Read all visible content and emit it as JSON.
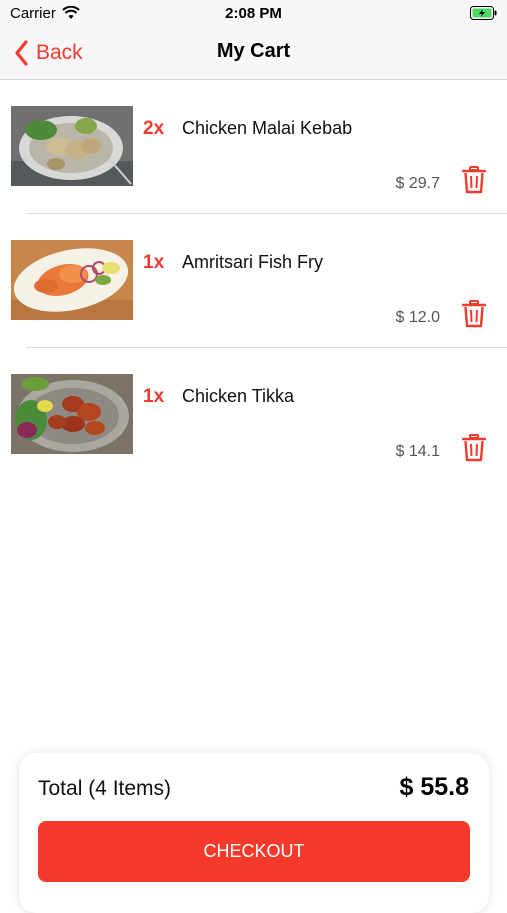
{
  "status_bar": {
    "carrier": "Carrier",
    "time": "2:08 PM"
  },
  "nav": {
    "back_label": "Back",
    "title": "My Cart"
  },
  "cart": {
    "items": [
      {
        "qty": "2x",
        "name": "Chicken Malai Kebab",
        "price": "$ 29.7"
      },
      {
        "qty": "1x",
        "name": "Amritsari Fish Fry",
        "price": "$ 12.0"
      },
      {
        "qty": "1x",
        "name": "Chicken Tikka",
        "price": "$ 14.1"
      }
    ]
  },
  "footer": {
    "total_label": "Total (4 Items)",
    "total_amount": "$ 55.8",
    "checkout_label": "CHECKOUT"
  },
  "colors": {
    "accent": "#f23a2f",
    "button": "#f53a2c"
  }
}
